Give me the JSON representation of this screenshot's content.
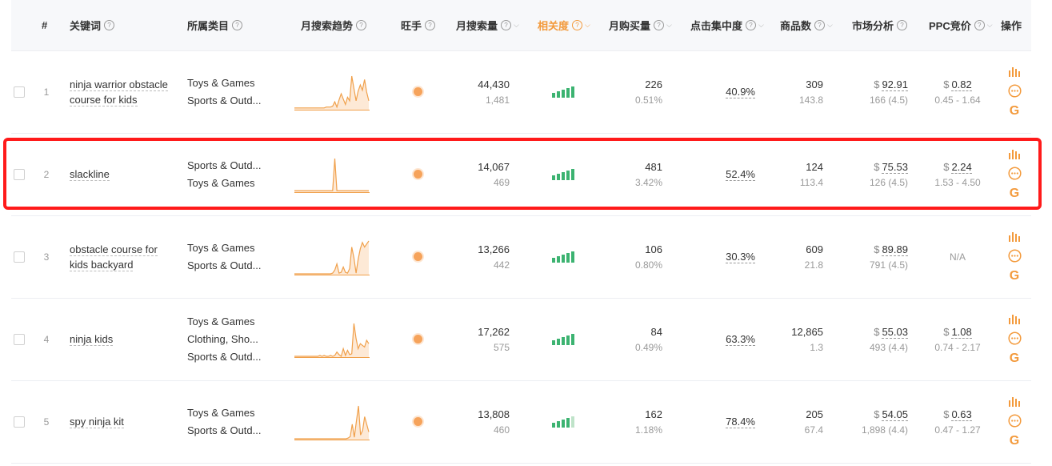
{
  "colors": {
    "accent": "#f39a3c",
    "spark": "#f0a04b",
    "bars": "#3cb371",
    "highlight": "#ff1a1a"
  },
  "header": {
    "num": "#",
    "keyword": "关键词",
    "category": "所属类目",
    "trend": "月搜索趋势",
    "wangshou": "旺手",
    "search_volume": "月搜索量",
    "relevance": "相关度",
    "monthly_purchases": "月购买量",
    "click_concentration": "点击集中度",
    "product_count": "商品数",
    "market_analysis": "市场分析",
    "ppc": "PPC竞价",
    "actions": "操作"
  },
  "rows": [
    {
      "num": "1",
      "keyword": "ninja warrior obstacle course for kids",
      "categories": [
        "Toys & Games",
        "Sports & Outd..."
      ],
      "trend": [
        2,
        2,
        2,
        2,
        2,
        2,
        2,
        2,
        2,
        2,
        2,
        2,
        2,
        2,
        2,
        3,
        3,
        3,
        4,
        9,
        3,
        11,
        18,
        12,
        6,
        14,
        10,
        38,
        24,
        10,
        21,
        28,
        22,
        34,
        20,
        10
      ],
      "search_volume": "44,430",
      "search_daily": "1,481",
      "relevance_level": 5,
      "purchases": "226",
      "purchase_rate": "0.51%",
      "click_concentration": "40.9%",
      "products": "309",
      "products_sub": "143.8",
      "market_price": "92.91",
      "market_sub": "166 (4.5)",
      "ppc": "0.82",
      "ppc_range": "0.45 - 1.64"
    },
    {
      "num": "2",
      "keyword": "slackline",
      "categories": [
        "Sports & Outd...",
        "Toys & Games"
      ],
      "trend": [
        2,
        2,
        2,
        2,
        2,
        2,
        2,
        2,
        2,
        2,
        2,
        2,
        2,
        2,
        2,
        2,
        2,
        2,
        2,
        45,
        2,
        2,
        2,
        2,
        2,
        2,
        2,
        2,
        2,
        2,
        2,
        2,
        2,
        2,
        2,
        2
      ],
      "search_volume": "14,067",
      "search_daily": "469",
      "relevance_level": 5,
      "purchases": "481",
      "purchase_rate": "3.42%",
      "click_concentration": "52.4%",
      "products": "124",
      "products_sub": "113.4",
      "market_price": "75.53",
      "market_sub": "126 (4.5)",
      "ppc": "2.24",
      "ppc_range": "1.53 - 4.50"
    },
    {
      "num": "3",
      "keyword": "obstacle course for kids backyard",
      "categories": [
        "Toys & Games",
        "Sports & Outd..."
      ],
      "trend": [
        1,
        1,
        1,
        1,
        1,
        1,
        1,
        1,
        1,
        1,
        1,
        1,
        1,
        1,
        1,
        1,
        1,
        1,
        2,
        6,
        14,
        2,
        3,
        10,
        3,
        2,
        8,
        36,
        22,
        2,
        20,
        34,
        42,
        36,
        40,
        44
      ],
      "search_volume": "13,266",
      "search_daily": "442",
      "relevance_level": 5,
      "purchases": "106",
      "purchase_rate": "0.80%",
      "click_concentration": "30.3%",
      "products": "609",
      "products_sub": "21.8",
      "market_price": "89.89",
      "market_sub": "791 (4.5)",
      "ppc": "N/A",
      "ppc_range": ""
    },
    {
      "num": "4",
      "keyword": "ninja kids",
      "categories": [
        "Toys & Games",
        "Clothing, Sho...",
        "Sports & Outd..."
      ],
      "trend": [
        1,
        1,
        1,
        1,
        1,
        1,
        1,
        1,
        1,
        1,
        1,
        1,
        2,
        1,
        2,
        1,
        1,
        2,
        1,
        2,
        6,
        3,
        1,
        10,
        2,
        8,
        3,
        4,
        40,
        22,
        10,
        16,
        14,
        12,
        20,
        16
      ],
      "search_volume": "17,262",
      "search_daily": "575",
      "relevance_level": 5,
      "purchases": "84",
      "purchase_rate": "0.49%",
      "click_concentration": "63.3%",
      "products": "12,865",
      "products_sub": "1.3",
      "market_price": "55.03",
      "market_sub": "493 (4.4)",
      "ppc": "1.08",
      "ppc_range": "0.74 - 2.17"
    },
    {
      "num": "5",
      "keyword": "spy ninja kit",
      "categories": [
        "Toys & Games",
        "Sports & Outd..."
      ],
      "trend": [
        1,
        1,
        1,
        1,
        1,
        1,
        1,
        1,
        1,
        1,
        1,
        1,
        1,
        1,
        1,
        1,
        1,
        1,
        1,
        1,
        1,
        1,
        1,
        1,
        1,
        1,
        2,
        4,
        20,
        3,
        24,
        44,
        6,
        12,
        30,
        20,
        10
      ],
      "search_volume": "13,808",
      "search_daily": "460",
      "relevance_level": 4,
      "purchases": "162",
      "purchase_rate": "1.18%",
      "click_concentration": "78.4%",
      "products": "205",
      "products_sub": "67.4",
      "market_price": "54.05",
      "market_sub": "1,898 (4.4)",
      "ppc": "0.63",
      "ppc_range": "0.47 - 1.27"
    }
  ],
  "currency_symbol": "$",
  "icons": {
    "chart": "bar-chart-icon",
    "more": "more-icon",
    "google": "google-icon"
  },
  "google_glyph": "G",
  "help_glyph": "?",
  "sort_glyph": "⌵",
  "highlighted_row": 2
}
